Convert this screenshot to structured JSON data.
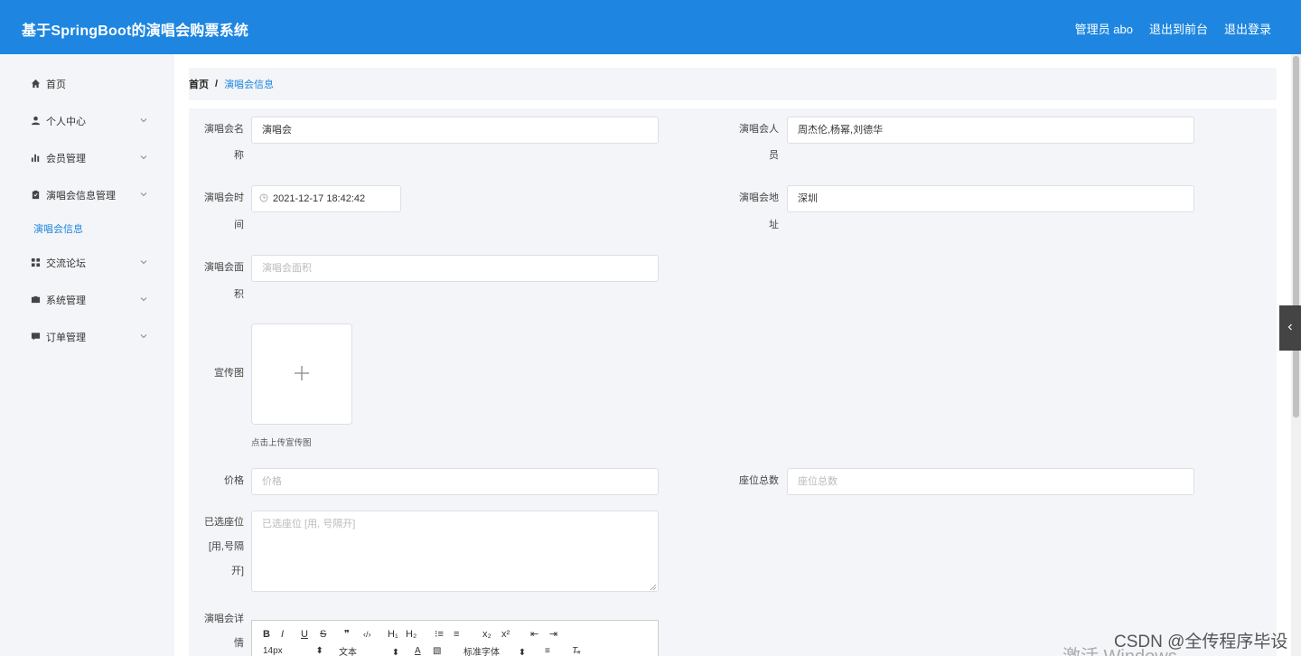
{
  "header": {
    "title": "基于SpringBoot的演唱会购票系统",
    "admin": "管理员 abo",
    "back_front": "退出到前台",
    "logout": "退出登录"
  },
  "sidebar": {
    "items": [
      {
        "label": "首页",
        "icon": "home-icon"
      },
      {
        "label": "个人中心",
        "icon": "user-icon"
      },
      {
        "label": "会员管理",
        "icon": "bar-chart-icon"
      },
      {
        "label": "演唱会信息管理",
        "icon": "clipboard-icon"
      },
      {
        "label": "交流论坛",
        "icon": "grid-icon"
      },
      {
        "label": "系统管理",
        "icon": "briefcase-icon"
      },
      {
        "label": "订单管理",
        "icon": "comment-icon"
      }
    ],
    "sub_item": "演唱会信息"
  },
  "breadcrumb": {
    "home": "首页",
    "sep": "/",
    "current": "演唱会信息"
  },
  "form": {
    "name_label_1": "演唱会名",
    "name_label_2": "称",
    "name_value": "演唱会",
    "staff_label_1": "演唱会人",
    "staff_label_2": "员",
    "staff_value": "周杰伦,杨幂,刘德华",
    "time_label_1": "演唱会时",
    "time_label_2": "间",
    "time_value": "2021-12-17 18:42:42",
    "address_label_1": "演唱会地",
    "address_label_2": "址",
    "address_value": "深圳",
    "area_label_1": "演唱会面",
    "area_label_2": "积",
    "area_placeholder": "演唱会面积",
    "poster_label": "宣传图",
    "poster_hint": "点击上传宣传图",
    "price_label": "价格",
    "price_placeholder": "价格",
    "seats_label": "座位总数",
    "seats_placeholder": "座位总数",
    "selected_label_1": "已选座位",
    "selected_label_2": "[用,号隔",
    "selected_label_3": "开]",
    "selected_placeholder": "已选座位 [用, 号隔开]",
    "detail_label_1": "演唱会详",
    "detail_label_2": "情"
  },
  "editor": {
    "row1": [
      "B",
      "I",
      "U",
      "S",
      "❞",
      "‹/›",
      "H₁",
      "H₂",
      "⁝≡",
      "≡",
      "x₂",
      "x²",
      "⇤",
      "⇥"
    ],
    "font_size": "14px",
    "text_type": "文本",
    "font_family": "标准字体"
  },
  "watermark": "CSDN @全传程序毕设",
  "activate_text": "激活 Windows"
}
